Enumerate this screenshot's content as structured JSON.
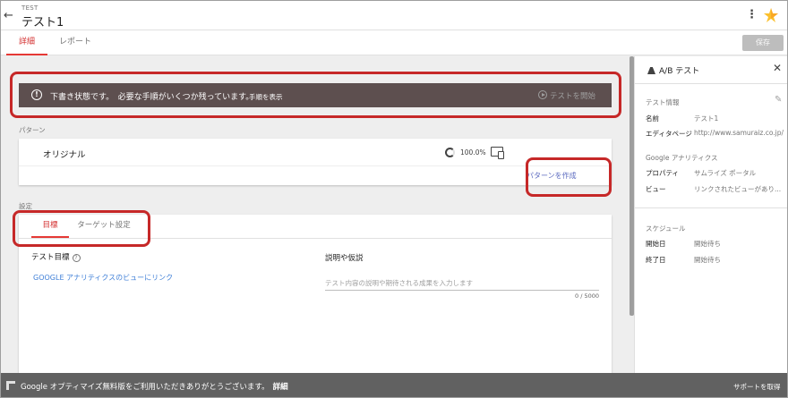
{
  "header": {
    "breadcrumb": "TEST",
    "title": "テスト1",
    "back_icon": "arrow-left-icon",
    "menu_icon": "kebab-icon"
  },
  "tabs": {
    "details": "詳細",
    "report": "レポート",
    "save_label": "保存"
  },
  "warning": {
    "message": "下書き状態です。　必要な手順がいくつか残っています。",
    "show_steps": "手順を表示",
    "start_test": "テストを開始"
  },
  "patterns": {
    "section_label": "パターン",
    "original_name": "オリジナル",
    "original_percent": "100.0%",
    "create_label": "パターンを作成"
  },
  "settings": {
    "section_label": "設定",
    "tab_goal": "目標",
    "tab_targeting": "ターゲット設定",
    "goal_label": "テスト目標",
    "help_glyph": "?",
    "ga_link": "GOOGLE アナリティクスのビューにリンク",
    "description_label": "説明や仮説",
    "description_placeholder": "テスト内容の説明や期待される成果を入力します",
    "counter": "0 / 5000"
  },
  "side_panel": {
    "title": "A/B テスト",
    "test_info_label": "テスト情報",
    "name_key": "名前",
    "name_value": "テスト1",
    "editor_key": "エディタページ",
    "editor_value": "http://www.samuraiz.co.jp/...",
    "ga_label": "Google アナリティクス",
    "property_key": "プロパティ",
    "property_value": "サムライズ ポータル",
    "view_key": "ビュー",
    "view_value": "リンクされたビューがあり...",
    "schedule_label": "スケジュール",
    "start_key": "開始日",
    "start_value": "開始待ち",
    "end_key": "終了日",
    "end_value": "開始待ち"
  },
  "footer": {
    "message": "Google オプティマイズ無料版をご利用いただきありがとうございます。",
    "detail_link": "詳細",
    "support": "サポートを取得"
  },
  "colors": {
    "accent": "#e53935",
    "warning_bg": "#5d4f4f",
    "link_blue": "#3f7fd7",
    "highlight": "#c62828"
  }
}
